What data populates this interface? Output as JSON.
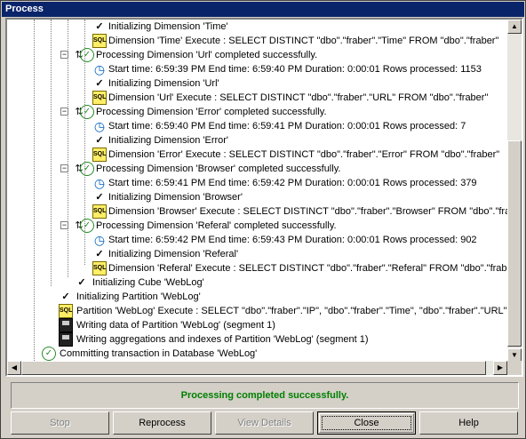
{
  "window": {
    "title": "Process"
  },
  "log": [
    "Initializing Dimension 'Time'",
    "Dimension 'Time' Execute : SELECT DISTINCT \"dbo\".\"fraber\".\"Time\" FROM \"dbo\".\"fraber\"",
    "Processing Dimension 'Url' completed successfully.",
    "Start time: 6:59:39 PM  End time: 6:59:40 PM  Duration: 0:00:01  Rows processed: 1153",
    "Initializing Dimension 'Url'",
    "Dimension 'Url' Execute : SELECT DISTINCT \"dbo\".\"fraber\".\"URL\" FROM \"dbo\".\"fraber\"",
    "Processing Dimension 'Error' completed successfully.",
    "Start time: 6:59:40 PM  End time: 6:59:41 PM  Duration: 0:00:01  Rows processed: 7",
    "Initializing Dimension 'Error'",
    "Dimension 'Error' Execute : SELECT DISTINCT \"dbo\".\"fraber\".\"Error\" FROM \"dbo\".\"fraber\"",
    "Processing Dimension 'Browser' completed successfully.",
    "Start time: 6:59:41 PM  End time: 6:59:42 PM  Duration: 0:00:01  Rows processed: 379",
    "Initializing Dimension 'Browser'",
    "Dimension 'Browser' Execute : SELECT DISTINCT \"dbo\".\"fraber\".\"Browser\" FROM \"dbo\".\"fraber\"",
    "Processing Dimension 'Referal' completed successfully.",
    "Start time: 6:59:42 PM  End time: 6:59:43 PM  Duration: 0:00:01  Rows processed: 902",
    "Initializing Dimension 'Referal'",
    "Dimension 'Referal' Execute : SELECT DISTINCT \"dbo\".\"fraber\".\"Referal\" FROM \"dbo\".\"fraber\"",
    "Initializing Cube 'WebLog'",
    "Initializing Partition 'WebLog'",
    "Partition 'WebLog' Execute : SELECT \"dbo\".\"fraber\".\"IP\", \"dbo\".\"fraber\".\"Time\", \"dbo\".\"fraber\".\"URL\",",
    "Writing data of Partition 'WebLog' (segment  1)",
    "Writing aggregations and indexes of Partition 'WebLog' (segment  1)",
    "Committing transaction in Database 'WebLog'"
  ],
  "sql_icon_label": "SQL",
  "status": {
    "message": "Processing completed successfully.",
    "color": "#008000"
  },
  "buttons": {
    "stop": "Stop",
    "reprocess": "Reprocess",
    "view_details": "View Details",
    "close": "Close",
    "help": "Help"
  }
}
